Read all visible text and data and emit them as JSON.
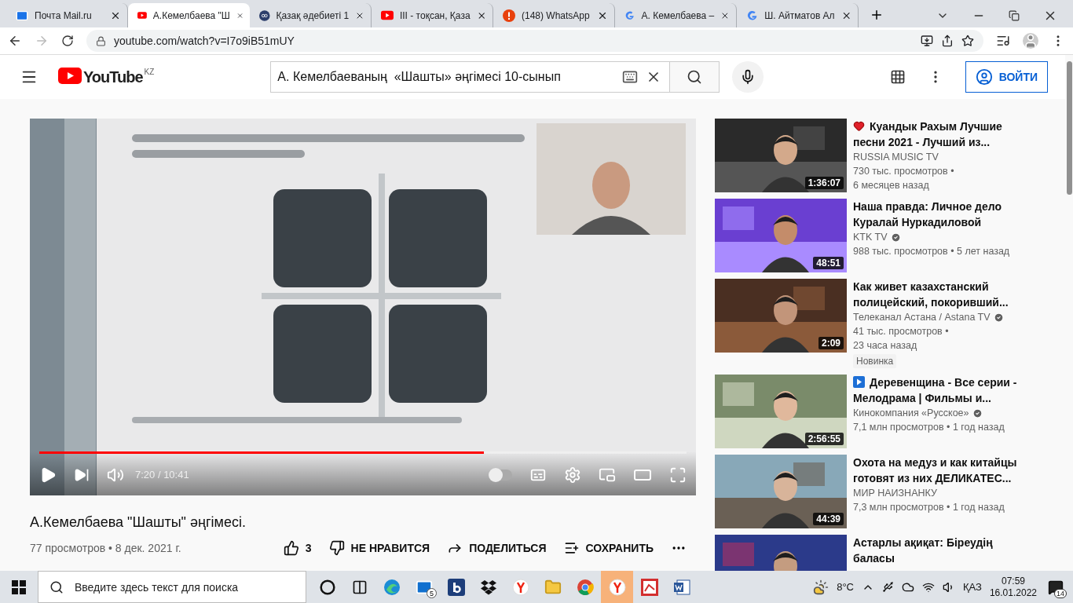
{
  "browser": {
    "tabs": [
      {
        "title": "Почта Mail.ru",
        "kind": "mail",
        "selected": false
      },
      {
        "title": "А.Кемелбаева \"Ш",
        "kind": "youtube",
        "selected": true
      },
      {
        "title": "Қазақ әдебиеті 1",
        "kind": "site",
        "selected": false
      },
      {
        "title": "III - тоқсан, Қаза",
        "kind": "youtube",
        "selected": false
      },
      {
        "title": "(148) WhatsApp",
        "kind": "alert",
        "selected": false
      },
      {
        "title": "А. Кемелбаева –",
        "kind": "google",
        "selected": false
      },
      {
        "title": "Ш. Айтматов Ал",
        "kind": "google",
        "selected": false
      }
    ],
    "url": "youtube.com/watch?v=I7o9iB51mUY"
  },
  "header": {
    "logo": "YouTube",
    "region": "KZ",
    "search": {
      "value": "А. Кемелбаеваның  «Шашты» әңгімесі 10-сынып"
    },
    "sign_in": "ВОЙТИ"
  },
  "player": {
    "progress": {
      "level": 0.687
    },
    "time": "7:20 / 10:41",
    "autoplay": {
      "on": false
    }
  },
  "video": {
    "title": "А.Кемелбаева \"Шашты\" әңгімесі.",
    "meta": "77 просмотров • 8 дек. 2021 г.",
    "likes": "3",
    "dislike": "НЕ НРАВИТСЯ",
    "share": "ПОДЕЛИТЬСЯ",
    "save": "СОХРАНИТЬ"
  },
  "related": [
    {
      "kind": "heart",
      "title": "Куандык Рахым Лучшие песни 2021 - Лучший из...",
      "channel": "RUSSIA MUSIC TV",
      "verified": false,
      "stats": [
        "730 тыс. просмотров •",
        "6 месяцев назад"
      ],
      "duration": "1:36:07"
    },
    {
      "kind": "plain",
      "title": "Наша правда: Личное дело Куралай Нуркадиловой",
      "channel": "KTK TV",
      "verified": true,
      "stats": [
        "988 тыс. просмотров • 5 лет назад"
      ],
      "duration": "48:51"
    },
    {
      "kind": "plain",
      "title": "Как живет казахстанский полицейский, покоривший...",
      "channel": "Телеканал Астана / Astana TV",
      "verified": true,
      "stats": [
        "41 тыс. просмотров •",
        "23 часа назад"
      ],
      "badge": "Новинка",
      "duration": "2:09"
    },
    {
      "kind": "play",
      "title": "Деревенщина - Все серии - Мелодрама | Фильмы и...",
      "channel": "Кинокомпания «Русское»",
      "verified": true,
      "stats": [
        "7,1 млн просмотров • 1 год назад"
      ],
      "duration": "2:56:55"
    },
    {
      "kind": "plain",
      "title": "Охота на медуз и как китайцы готовят из них ДЕЛИКАТЕС...",
      "channel": "МИР НАИЗНАНКУ",
      "verified": false,
      "stats": [
        "7,3 млн просмотров • 1 год назад"
      ],
      "duration": "44:39"
    },
    {
      "kind": "plain",
      "title": "Астарлы ақиқат: Біреудің баласы"
    }
  ],
  "taskbar": {
    "search": {
      "placeholder": "Введите здесь текст для поиска"
    },
    "apps": [
      {
        "kind": "cortana",
        "selected": false
      },
      {
        "kind": "taskview",
        "selected": false
      },
      {
        "kind": "edge",
        "selected": false
      },
      {
        "kind": "mail",
        "selected": false,
        "badge": "5"
      },
      {
        "kind": "booking",
        "selected": false
      },
      {
        "kind": "dropbox",
        "selected": false
      },
      {
        "kind": "yandex",
        "selected": false
      },
      {
        "kind": "explorer",
        "selected": false
      },
      {
        "kind": "chrome",
        "selected": false
      },
      {
        "kind": "yandex",
        "selected": true
      },
      {
        "kind": "redapp",
        "selected": false
      },
      {
        "kind": "word",
        "selected": false
      }
    ],
    "weather": "8°C",
    "language": "ҚАЗ",
    "time": "07:59",
    "date": "16.01.2022",
    "notifications": "14"
  }
}
